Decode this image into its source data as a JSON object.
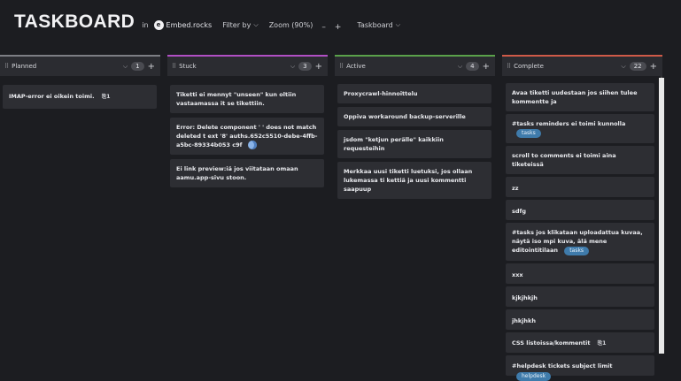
{
  "header": {
    "title": "TASKBOARD",
    "in_label": "in",
    "org_name": "Embed.rocks",
    "filter_label": "Filter by",
    "zoom_label": "Zoom (90%)",
    "zoom_minus": "–",
    "zoom_plus": "+",
    "view_label": "Taskboard"
  },
  "columns": [
    {
      "title": "Planned",
      "count": "1",
      "accent": "#7d7e84",
      "cards": [
        {
          "text": "IMAP-error ei oikein toimi.",
          "attachments": "1"
        }
      ]
    },
    {
      "title": "Stuck",
      "count": "3",
      "accent": "#b14fc4",
      "cards": [
        {
          "text": "Tiketti ei mennyt \"unseen\" kun oltiin vastaamassa it se tikettiin."
        },
        {
          "text": "Error: Delete component ' ' does not match deleted t ext '8' auths.652c5510-debe-4ffb-a5bc-89334b053 c9f"
        },
        {
          "text": "Ei link preview:iä jos viitataan omaan aamu.app-sivu stoon."
        }
      ]
    },
    {
      "title": "Active",
      "count": "4",
      "accent": "#5aa14a",
      "cards": [
        {
          "text": "Proxycrawl-hinnoittelu"
        },
        {
          "text": "Oppiva workaround backup-serverille"
        },
        {
          "text": "jsdom \"ketjun perälle\" kaikkiin requesteihin"
        },
        {
          "text": "Merkkaa uusi tiketti luetuksi, jos ollaan lukemassa ti kettiä ja uusi kommentti saapuup"
        }
      ]
    },
    {
      "title": "Complete",
      "count": "22",
      "accent": "#cf5a48",
      "cards": [
        {
          "text": "Avaa tiketti uudestaan jos siihen tulee kommentte ja"
        },
        {
          "text": "#tasks reminders ei toimi kunnolla",
          "tag": "tasks"
        },
        {
          "text": "scroll to comments ei toimi aina tiketeissä"
        },
        {
          "text": "zz"
        },
        {
          "text": "sdfg"
        },
        {
          "text": "#tasks jos klikataan uploadattua kuvaa, näytä iso mpi kuva, älä mene editointitilaan",
          "tag": "tasks"
        },
        {
          "text": "xxx"
        },
        {
          "text": "kjkjhkjh"
        },
        {
          "text": "jhkjhkh"
        },
        {
          "text": "CSS listoissa/kommentit",
          "attachments": "1"
        },
        {
          "text": "#helpdesk tickets subject limit",
          "tag": "helpdesk"
        }
      ]
    }
  ]
}
